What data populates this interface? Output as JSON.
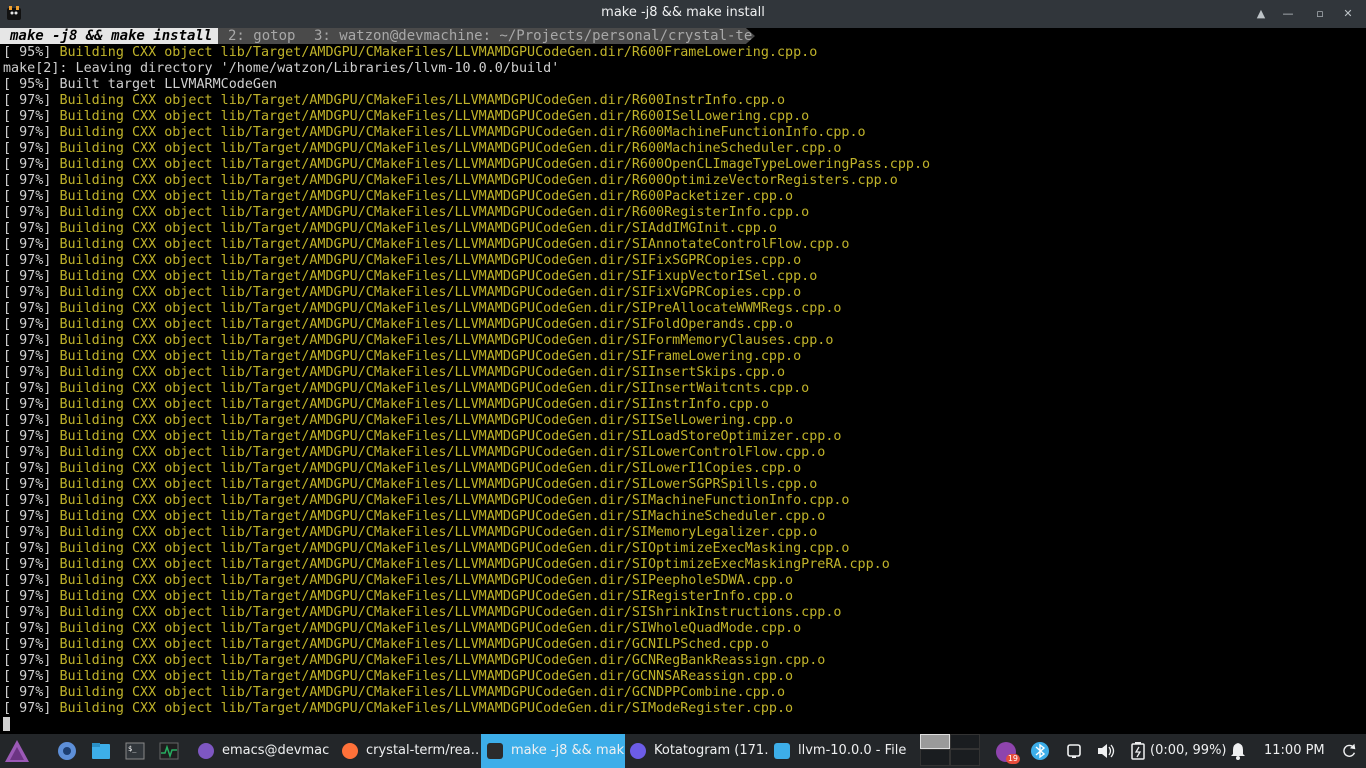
{
  "window": {
    "title": "make -j8 && make install",
    "controls": [
      "▲",
      "—",
      "▫",
      "✕"
    ]
  },
  "tabs": [
    {
      "label": "make -j8 && make install"
    },
    {
      "label": "2: gotop"
    },
    {
      "label": "3: watzon@devmachine: ~/Projects/personal/crystal-te…"
    }
  ],
  "terminal": {
    "lines": [
      {
        "pct": "[ 95%] ",
        "text": "Building CXX object lib/Target/AMDGPU/CMakeFiles/LLVMAMDGPUCodeGen.dir/R600FrameLowering.cpp.o",
        "style": "y"
      },
      {
        "pct": "",
        "text": "make[2]: Leaving directory '/home/watzon/Libraries/llvm-10.0.0/build'",
        "style": "w"
      },
      {
        "pct": "[ 95%] ",
        "text": "Built target LLVMARMCodeGen",
        "style": "w"
      },
      {
        "pct": "[ 97%] ",
        "text": "Building CXX object lib/Target/AMDGPU/CMakeFiles/LLVMAMDGPUCodeGen.dir/R600InstrInfo.cpp.o",
        "style": "y"
      },
      {
        "pct": "[ 97%] ",
        "text": "Building CXX object lib/Target/AMDGPU/CMakeFiles/LLVMAMDGPUCodeGen.dir/R600ISelLowering.cpp.o",
        "style": "y"
      },
      {
        "pct": "[ 97%] ",
        "text": "Building CXX object lib/Target/AMDGPU/CMakeFiles/LLVMAMDGPUCodeGen.dir/R600MachineFunctionInfo.cpp.o",
        "style": "y"
      },
      {
        "pct": "[ 97%] ",
        "text": "Building CXX object lib/Target/AMDGPU/CMakeFiles/LLVMAMDGPUCodeGen.dir/R600MachineScheduler.cpp.o",
        "style": "y"
      },
      {
        "pct": "[ 97%] ",
        "text": "Building CXX object lib/Target/AMDGPU/CMakeFiles/LLVMAMDGPUCodeGen.dir/R600OpenCLImageTypeLoweringPass.cpp.o",
        "style": "y"
      },
      {
        "pct": "[ 97%] ",
        "text": "Building CXX object lib/Target/AMDGPU/CMakeFiles/LLVMAMDGPUCodeGen.dir/R600OptimizeVectorRegisters.cpp.o",
        "style": "y"
      },
      {
        "pct": "[ 97%] ",
        "text": "Building CXX object lib/Target/AMDGPU/CMakeFiles/LLVMAMDGPUCodeGen.dir/R600Packetizer.cpp.o",
        "style": "y"
      },
      {
        "pct": "[ 97%] ",
        "text": "Building CXX object lib/Target/AMDGPU/CMakeFiles/LLVMAMDGPUCodeGen.dir/R600RegisterInfo.cpp.o",
        "style": "y"
      },
      {
        "pct": "[ 97%] ",
        "text": "Building CXX object lib/Target/AMDGPU/CMakeFiles/LLVMAMDGPUCodeGen.dir/SIAddIMGInit.cpp.o",
        "style": "y"
      },
      {
        "pct": "[ 97%] ",
        "text": "Building CXX object lib/Target/AMDGPU/CMakeFiles/LLVMAMDGPUCodeGen.dir/SIAnnotateControlFlow.cpp.o",
        "style": "y"
      },
      {
        "pct": "[ 97%] ",
        "text": "Building CXX object lib/Target/AMDGPU/CMakeFiles/LLVMAMDGPUCodeGen.dir/SIFixSGPRCopies.cpp.o",
        "style": "y"
      },
      {
        "pct": "[ 97%] ",
        "text": "Building CXX object lib/Target/AMDGPU/CMakeFiles/LLVMAMDGPUCodeGen.dir/SIFixupVectorISel.cpp.o",
        "style": "y"
      },
      {
        "pct": "[ 97%] ",
        "text": "Building CXX object lib/Target/AMDGPU/CMakeFiles/LLVMAMDGPUCodeGen.dir/SIFixVGPRCopies.cpp.o",
        "style": "y"
      },
      {
        "pct": "[ 97%] ",
        "text": "Building CXX object lib/Target/AMDGPU/CMakeFiles/LLVMAMDGPUCodeGen.dir/SIPreAllocateWWMRegs.cpp.o",
        "style": "y"
      },
      {
        "pct": "[ 97%] ",
        "text": "Building CXX object lib/Target/AMDGPU/CMakeFiles/LLVMAMDGPUCodeGen.dir/SIFoldOperands.cpp.o",
        "style": "y"
      },
      {
        "pct": "[ 97%] ",
        "text": "Building CXX object lib/Target/AMDGPU/CMakeFiles/LLVMAMDGPUCodeGen.dir/SIFormMemoryClauses.cpp.o",
        "style": "y"
      },
      {
        "pct": "[ 97%] ",
        "text": "Building CXX object lib/Target/AMDGPU/CMakeFiles/LLVMAMDGPUCodeGen.dir/SIFrameLowering.cpp.o",
        "style": "y"
      },
      {
        "pct": "[ 97%] ",
        "text": "Building CXX object lib/Target/AMDGPU/CMakeFiles/LLVMAMDGPUCodeGen.dir/SIInsertSkips.cpp.o",
        "style": "y"
      },
      {
        "pct": "[ 97%] ",
        "text": "Building CXX object lib/Target/AMDGPU/CMakeFiles/LLVMAMDGPUCodeGen.dir/SIInsertWaitcnts.cpp.o",
        "style": "y"
      },
      {
        "pct": "[ 97%] ",
        "text": "Building CXX object lib/Target/AMDGPU/CMakeFiles/LLVMAMDGPUCodeGen.dir/SIInstrInfo.cpp.o",
        "style": "y"
      },
      {
        "pct": "[ 97%] ",
        "text": "Building CXX object lib/Target/AMDGPU/CMakeFiles/LLVMAMDGPUCodeGen.dir/SIISelLowering.cpp.o",
        "style": "y"
      },
      {
        "pct": "[ 97%] ",
        "text": "Building CXX object lib/Target/AMDGPU/CMakeFiles/LLVMAMDGPUCodeGen.dir/SILoadStoreOptimizer.cpp.o",
        "style": "y"
      },
      {
        "pct": "[ 97%] ",
        "text": "Building CXX object lib/Target/AMDGPU/CMakeFiles/LLVMAMDGPUCodeGen.dir/SILowerControlFlow.cpp.o",
        "style": "y"
      },
      {
        "pct": "[ 97%] ",
        "text": "Building CXX object lib/Target/AMDGPU/CMakeFiles/LLVMAMDGPUCodeGen.dir/SILowerI1Copies.cpp.o",
        "style": "y"
      },
      {
        "pct": "[ 97%] ",
        "text": "Building CXX object lib/Target/AMDGPU/CMakeFiles/LLVMAMDGPUCodeGen.dir/SILowerSGPRSpills.cpp.o",
        "style": "y"
      },
      {
        "pct": "[ 97%] ",
        "text": "Building CXX object lib/Target/AMDGPU/CMakeFiles/LLVMAMDGPUCodeGen.dir/SIMachineFunctionInfo.cpp.o",
        "style": "y"
      },
      {
        "pct": "[ 97%] ",
        "text": "Building CXX object lib/Target/AMDGPU/CMakeFiles/LLVMAMDGPUCodeGen.dir/SIMachineScheduler.cpp.o",
        "style": "y"
      },
      {
        "pct": "[ 97%] ",
        "text": "Building CXX object lib/Target/AMDGPU/CMakeFiles/LLVMAMDGPUCodeGen.dir/SIMemoryLegalizer.cpp.o",
        "style": "y"
      },
      {
        "pct": "[ 97%] ",
        "text": "Building CXX object lib/Target/AMDGPU/CMakeFiles/LLVMAMDGPUCodeGen.dir/SIOptimizeExecMasking.cpp.o",
        "style": "y"
      },
      {
        "pct": "[ 97%] ",
        "text": "Building CXX object lib/Target/AMDGPU/CMakeFiles/LLVMAMDGPUCodeGen.dir/SIOptimizeExecMaskingPreRA.cpp.o",
        "style": "y"
      },
      {
        "pct": "[ 97%] ",
        "text": "Building CXX object lib/Target/AMDGPU/CMakeFiles/LLVMAMDGPUCodeGen.dir/SIPeepholeSDWA.cpp.o",
        "style": "y"
      },
      {
        "pct": "[ 97%] ",
        "text": "Building CXX object lib/Target/AMDGPU/CMakeFiles/LLVMAMDGPUCodeGen.dir/SIRegisterInfo.cpp.o",
        "style": "y"
      },
      {
        "pct": "[ 97%] ",
        "text": "Building CXX object lib/Target/AMDGPU/CMakeFiles/LLVMAMDGPUCodeGen.dir/SIShrinkInstructions.cpp.o",
        "style": "y"
      },
      {
        "pct": "[ 97%] ",
        "text": "Building CXX object lib/Target/AMDGPU/CMakeFiles/LLVMAMDGPUCodeGen.dir/SIWholeQuadMode.cpp.o",
        "style": "y"
      },
      {
        "pct": "[ 97%] ",
        "text": "Building CXX object lib/Target/AMDGPU/CMakeFiles/LLVMAMDGPUCodeGen.dir/GCNILPSched.cpp.o",
        "style": "y"
      },
      {
        "pct": "[ 97%] ",
        "text": "Building CXX object lib/Target/AMDGPU/CMakeFiles/LLVMAMDGPUCodeGen.dir/GCNRegBankReassign.cpp.o",
        "style": "y"
      },
      {
        "pct": "[ 97%] ",
        "text": "Building CXX object lib/Target/AMDGPU/CMakeFiles/LLVMAMDGPUCodeGen.dir/GCNNSAReassign.cpp.o",
        "style": "y"
      },
      {
        "pct": "[ 97%] ",
        "text": "Building CXX object lib/Target/AMDGPU/CMakeFiles/LLVMAMDGPUCodeGen.dir/GCNDPPCombine.cpp.o",
        "style": "y"
      },
      {
        "pct": "[ 97%] ",
        "text": "Building CXX object lib/Target/AMDGPU/CMakeFiles/LLVMAMDGPUCodeGen.dir/SIModeRegister.cpp.o",
        "style": "y"
      }
    ]
  },
  "taskbar": {
    "tasks": [
      {
        "label": "emacs@devmac…",
        "icon": "emacs-icon",
        "color": "#7e57c2"
      },
      {
        "label": "crystal-term/rea…",
        "icon": "firefox-icon",
        "color": "#ff7139"
      },
      {
        "label": "make -j8 && mak…",
        "icon": "terminal-app-icon",
        "color": "#2b2b2b",
        "active": true
      },
      {
        "label": "Kotatogram (171…",
        "icon": "kotatogram-icon",
        "color": "#6c5ce7"
      },
      {
        "label": "llvm-10.0.0 - File …",
        "icon": "folder-app-icon",
        "color": "#3daee9"
      }
    ],
    "tray": {
      "battery": "(0:00, 99%)",
      "clock": "11:00 PM",
      "badge": "19"
    }
  }
}
